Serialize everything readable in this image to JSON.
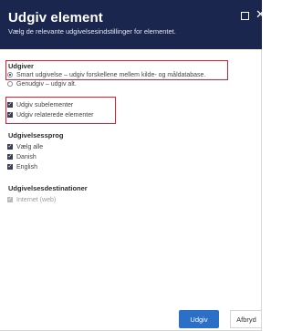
{
  "dialog": {
    "title": "Udgiv element",
    "subtitle": "Vælg de relevante udgivelsesindstillinger for elementet."
  },
  "publish": {
    "section_title": "Udgiver",
    "options": [
      {
        "label": "Smart udgivelse – udgiv forskellene mellem kilde- og måldatabase.",
        "checked": true
      },
      {
        "label": "Genudgiv – udgiv alt.",
        "checked": false
      }
    ]
  },
  "subitems": {
    "options": [
      {
        "label": "Udgiv subelementer",
        "checked": true
      },
      {
        "label": "Udgiv relaterede elementer",
        "checked": true
      }
    ]
  },
  "languages": {
    "section_title": "Udgivelsessprog",
    "options": [
      {
        "label": "Vælg alle",
        "checked": true
      },
      {
        "label": "Danish",
        "checked": true
      },
      {
        "label": "English",
        "checked": true
      }
    ]
  },
  "targets": {
    "section_title": "Udgivelsesdestinationer",
    "options": [
      {
        "label": "Internet (web)",
        "checked": true,
        "disabled": true
      }
    ]
  },
  "footer": {
    "publish_label": "Udgiv",
    "cancel_label": "Afbryd"
  },
  "colors": {
    "header": "#1b264f",
    "primary_button": "#2b6fc7",
    "highlight": "#cc2233"
  }
}
